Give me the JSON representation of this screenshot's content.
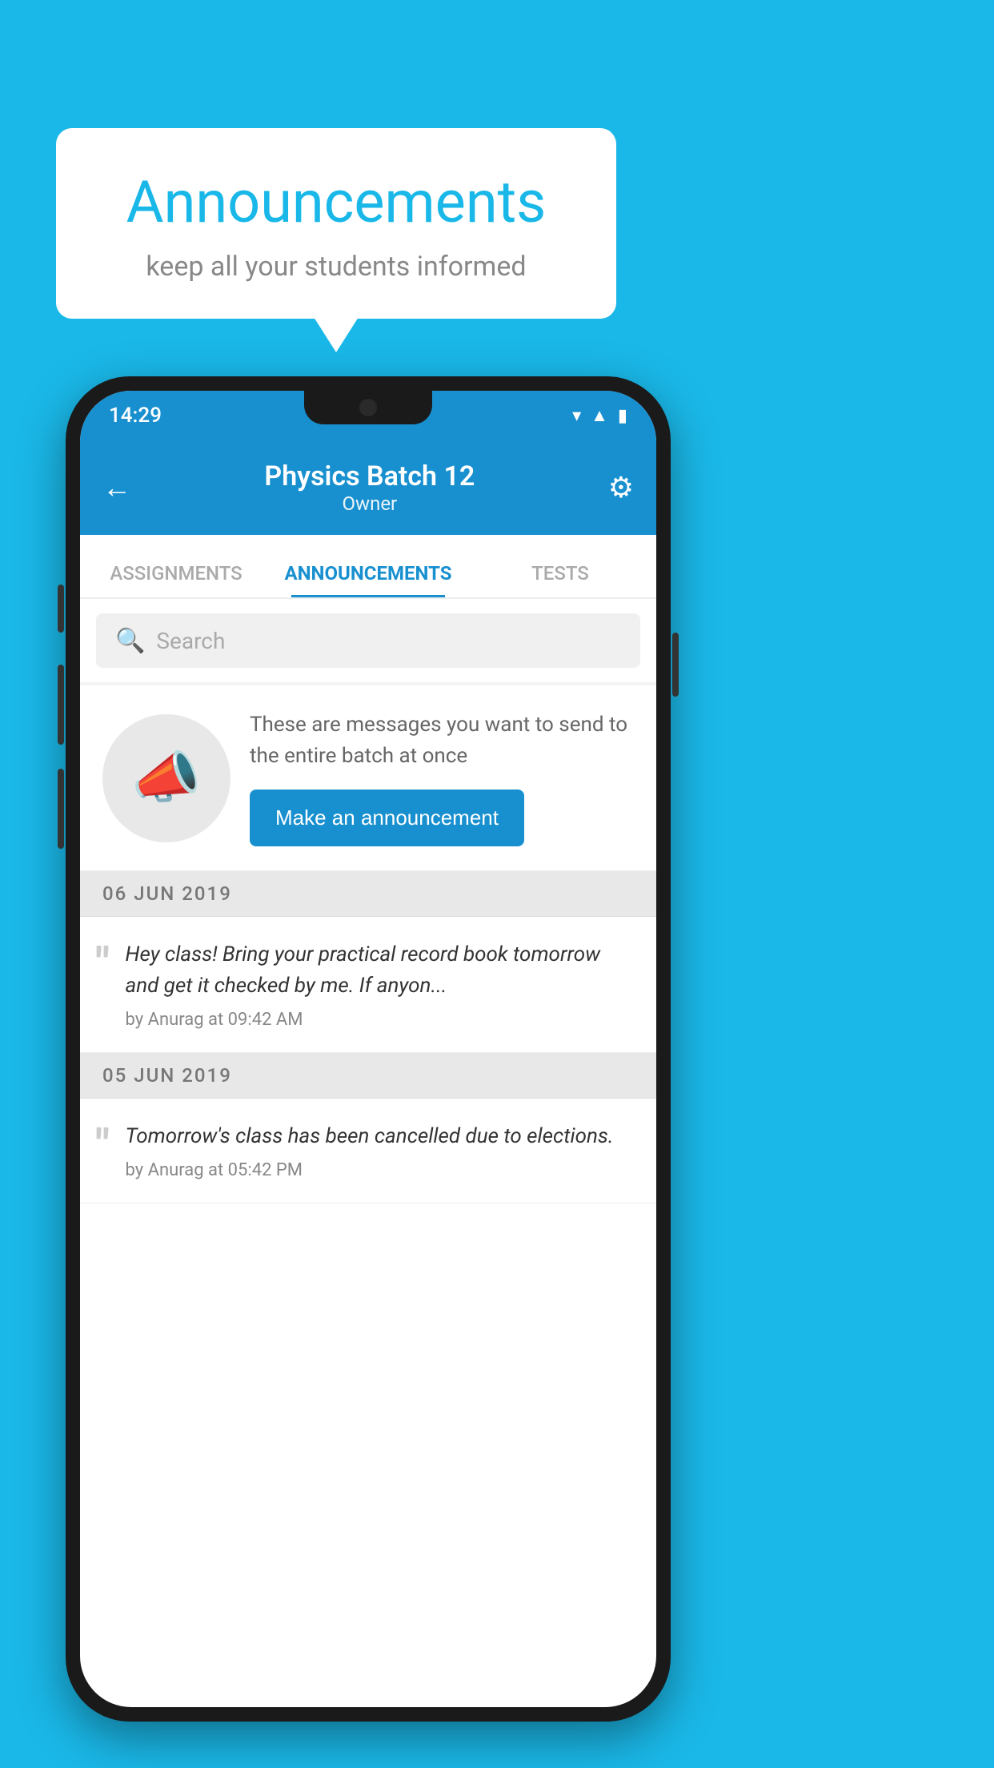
{
  "page": {
    "background_color": "#1ab8e8"
  },
  "speech_bubble": {
    "title": "Announcements",
    "subtitle": "keep all your students informed"
  },
  "phone": {
    "status_bar": {
      "time": "14:29",
      "icons": [
        "wifi",
        "signal",
        "battery"
      ]
    },
    "app_bar": {
      "title": "Physics Batch 12",
      "subtitle": "Owner",
      "back_label": "←",
      "settings_label": "⚙"
    },
    "tabs": [
      {
        "label": "ASSIGNMENTS",
        "active": false
      },
      {
        "label": "ANNOUNCEMENTS",
        "active": true
      },
      {
        "label": "TESTS",
        "active": false
      }
    ],
    "search": {
      "placeholder": "Search"
    },
    "promo": {
      "description": "These are messages you want to send to the entire batch at once",
      "button_label": "Make an announcement"
    },
    "announcements": [
      {
        "date": "06  JUN  2019",
        "text": "Hey class! Bring your practical record book tomorrow and get it checked by me. If anyon...",
        "meta": "by Anurag at 09:42 AM"
      },
      {
        "date": "05  JUN  2019",
        "text": "Tomorrow's class has been cancelled due to elections.",
        "meta": "by Anurag at 05:42 PM"
      }
    ]
  }
}
